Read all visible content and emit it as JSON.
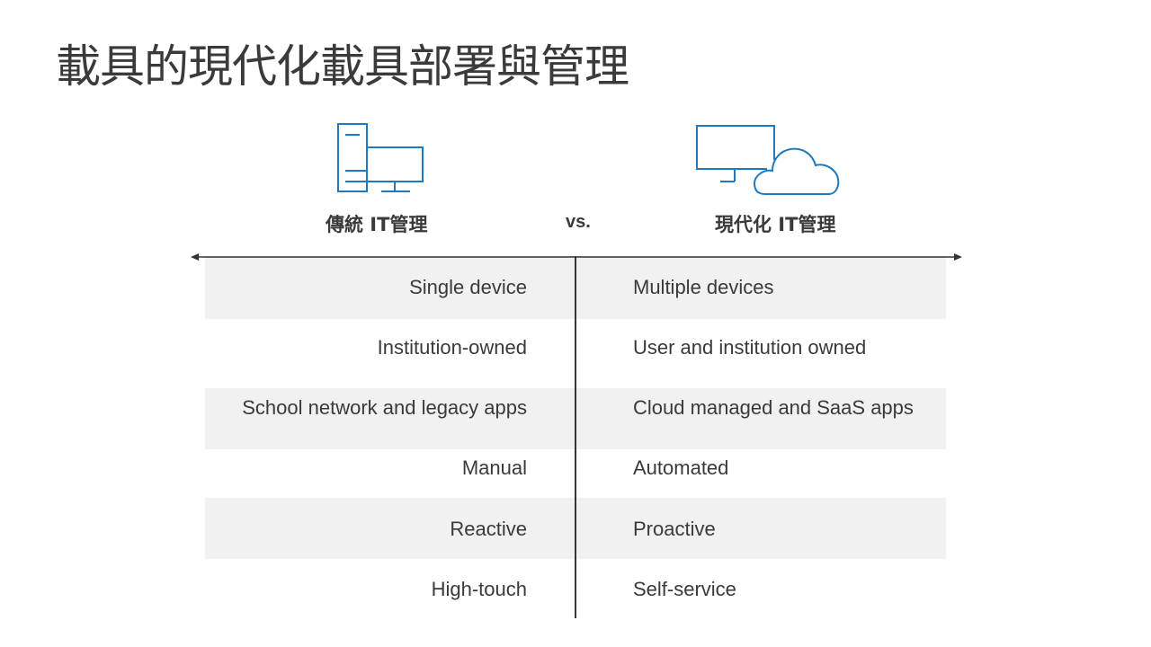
{
  "title": "載具的現代化載具部署與管理",
  "colors": {
    "accent": "#1e7ac0",
    "text": "#3a3a3a",
    "band": "#f1f1f1",
    "divider": "#333333"
  },
  "header": {
    "left": {
      "label": "傳統 IT管理",
      "icon": "desktop-tower-monitor-icon"
    },
    "vs": "vs.",
    "right": {
      "label": "現代化 IT管理",
      "icon": "monitor-cloud-icon"
    }
  },
  "comparison": {
    "rows": [
      {
        "traditional": "Single device",
        "modern": "Multiple devices",
        "shaded": true
      },
      {
        "traditional": "Institution-owned",
        "modern": "User and institution owned",
        "shaded": false
      },
      {
        "traditional": "School network and legacy apps",
        "modern": "Cloud managed and SaaS apps",
        "shaded": true
      },
      {
        "traditional": "Manual",
        "modern": "Automated",
        "shaded": false
      },
      {
        "traditional": "Reactive",
        "modern": "Proactive",
        "shaded": true
      },
      {
        "traditional": "High-touch",
        "modern": "Self-service",
        "shaded": false
      }
    ]
  }
}
